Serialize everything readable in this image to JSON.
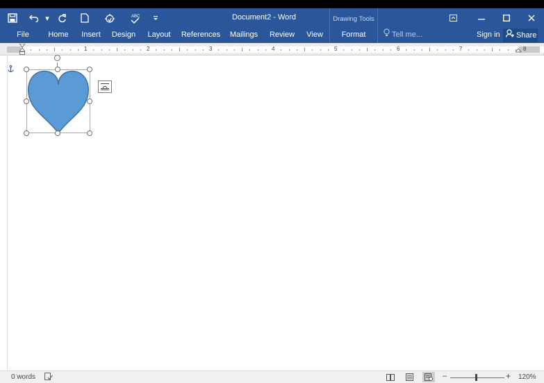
{
  "window": {
    "title": "Document2 - Word",
    "contextual_tab_group": "Drawing Tools"
  },
  "quick_access": {
    "icons": [
      "save-icon",
      "undo-icon",
      "redo-icon",
      "new-document-icon",
      "touch-mode-icon",
      "spelling-icon",
      "customize-qat-icon"
    ]
  },
  "window_controls": [
    "ribbon-display-options-icon",
    "minimize-icon",
    "maximize-icon",
    "close-icon"
  ],
  "ribbon": {
    "tabs": [
      {
        "label": "File"
      },
      {
        "label": "Home"
      },
      {
        "label": "Insert"
      },
      {
        "label": "Design"
      },
      {
        "label": "Layout"
      },
      {
        "label": "References"
      },
      {
        "label": "Mailings"
      },
      {
        "label": "Review"
      },
      {
        "label": "View"
      },
      {
        "label": "Format"
      }
    ],
    "active_tab": "Format",
    "tell_me": "Tell me...",
    "sign_in": "Sign in",
    "share": "Share"
  },
  "ruler": {
    "numbers": [
      "1",
      "2",
      "3",
      "4",
      "5",
      "6",
      "7",
      "8"
    ]
  },
  "document": {
    "shape": {
      "type": "heart",
      "fill_color": "#5b9bd5",
      "outline_color": "#41719c",
      "selected": true
    }
  },
  "status": {
    "word_count": "0 words",
    "zoom_minus": "–",
    "zoom_plus": "+",
    "zoom": "120%",
    "zoom_level": 1.2,
    "views": [
      "read-mode-icon",
      "print-layout-icon",
      "web-layout-icon"
    ],
    "active_view": "web-layout-icon"
  },
  "colors": {
    "accent": "#2b579a",
    "statusbar": "#f0f0f0"
  }
}
